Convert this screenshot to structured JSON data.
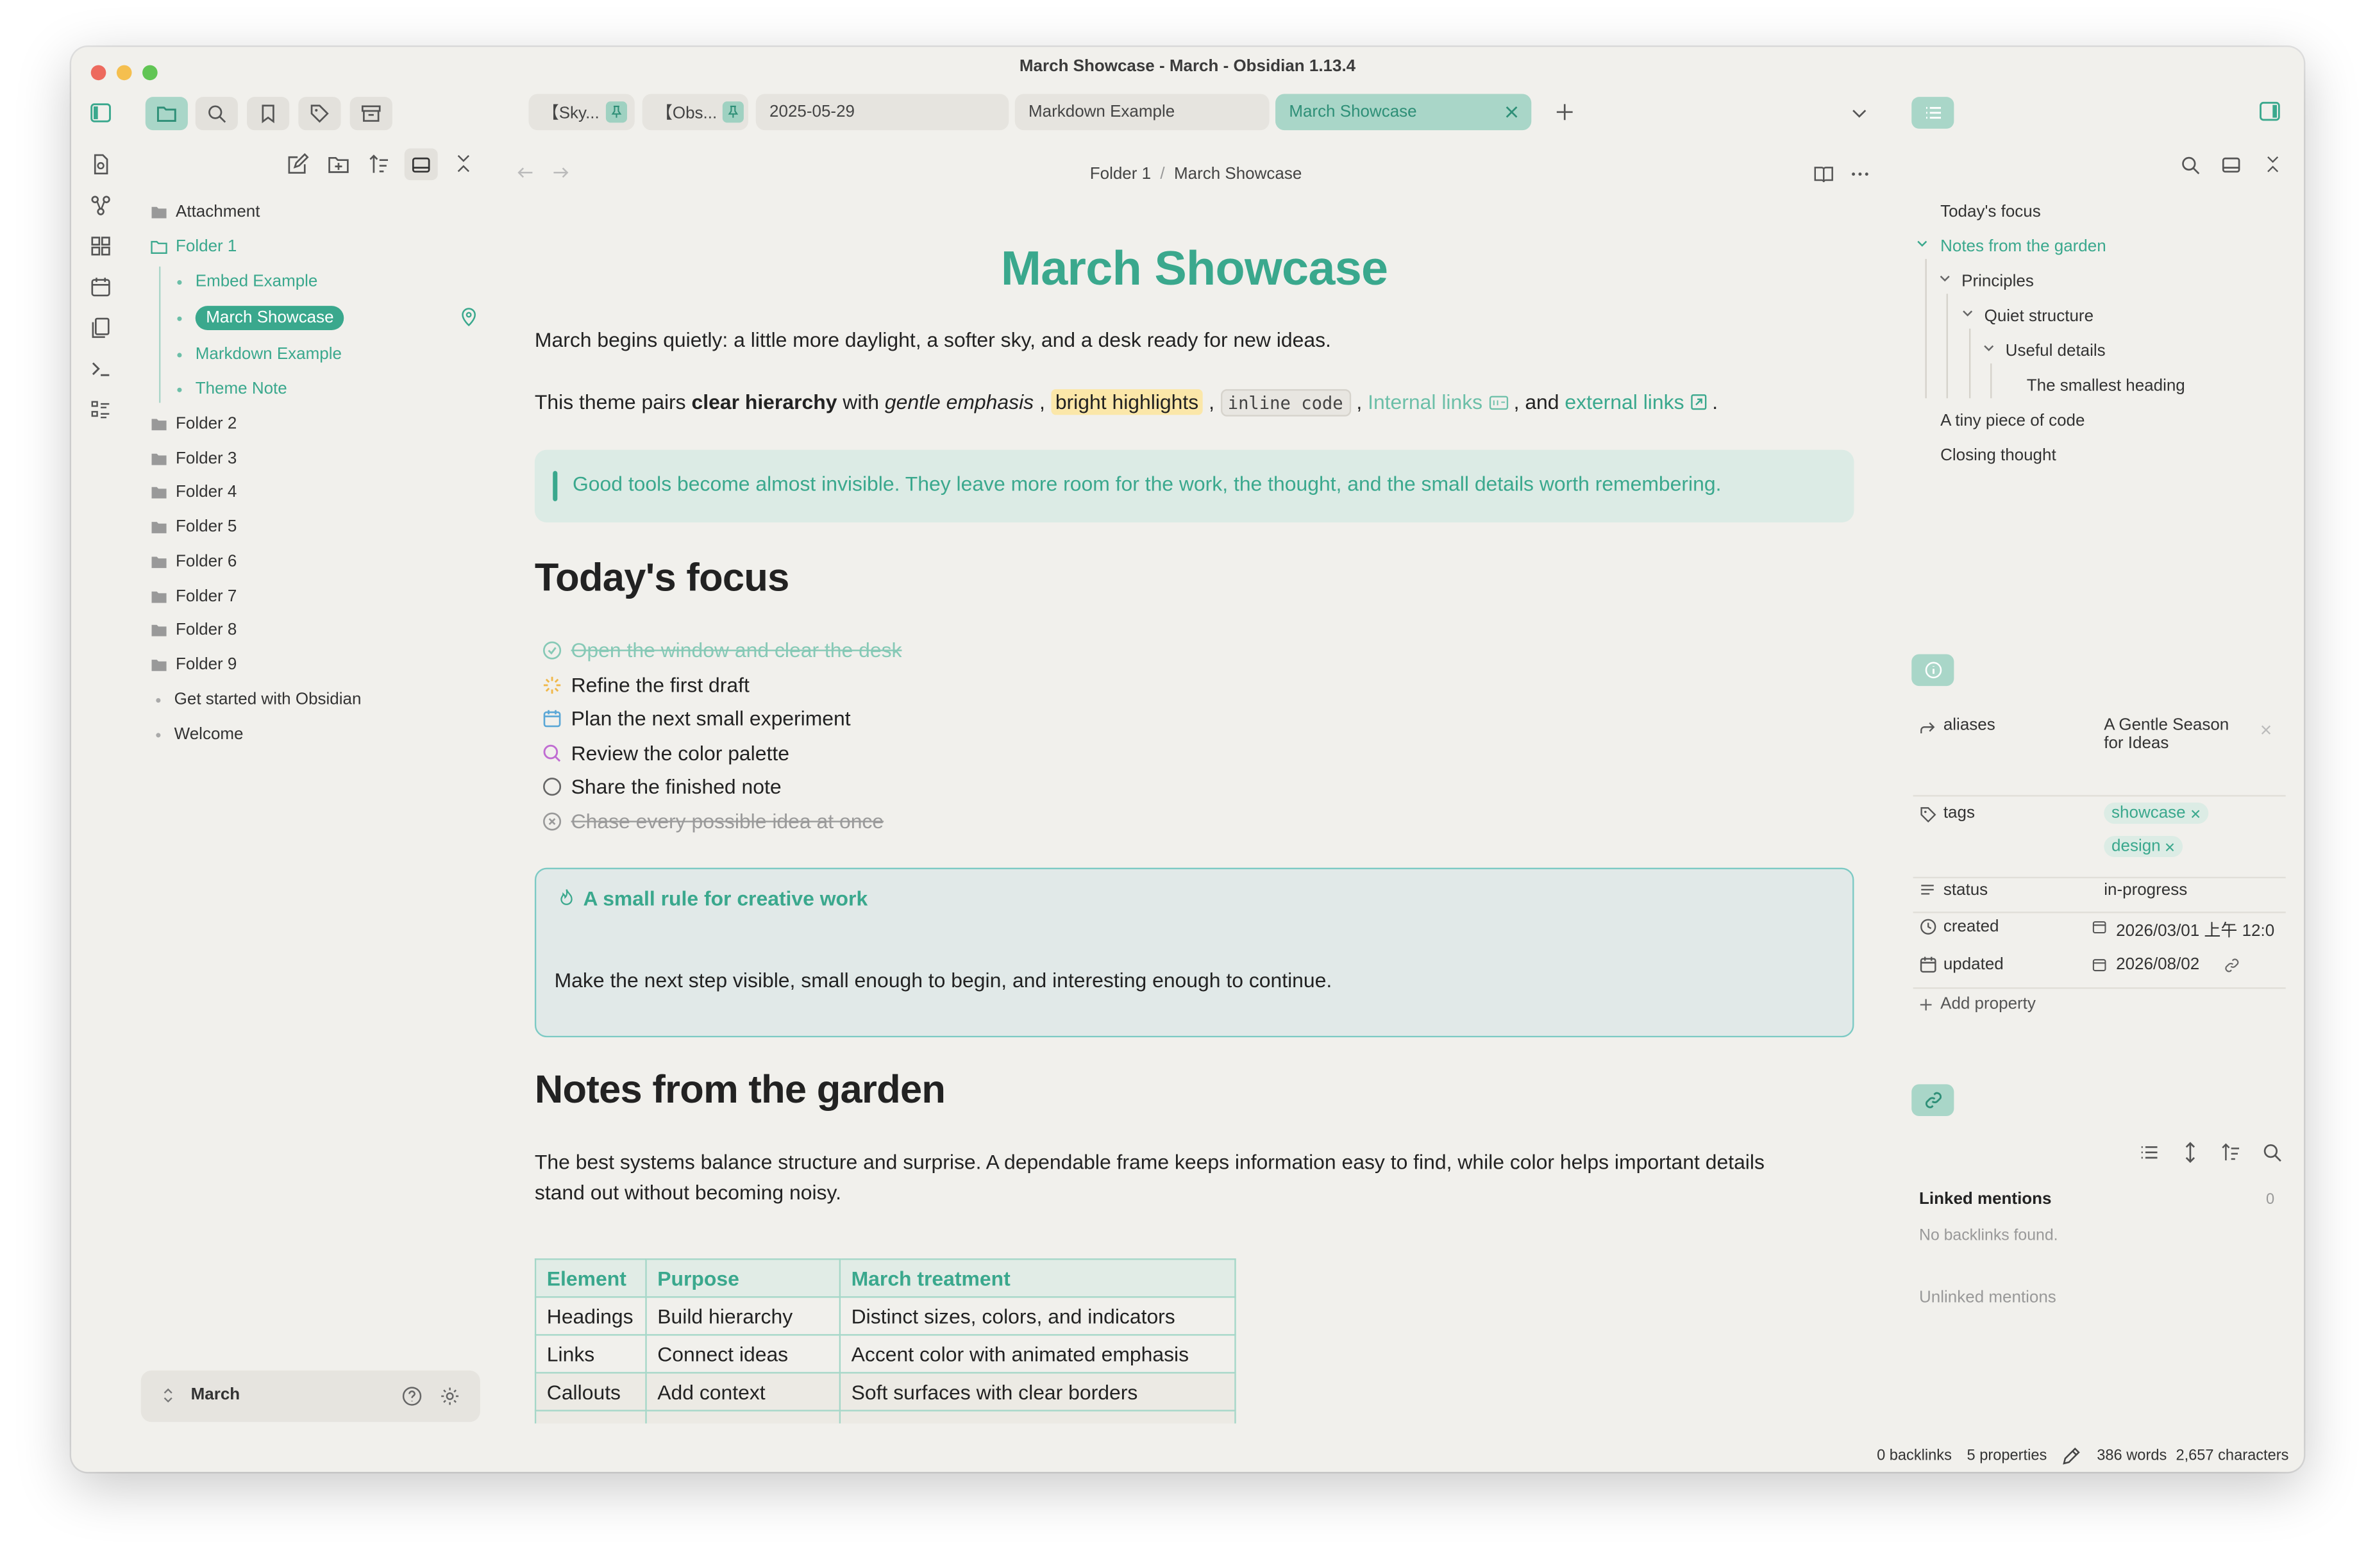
{
  "window": {
    "title": "March Showcase - March - Obsidian 1.13.4"
  },
  "colors": {
    "accent": "#3aa88d",
    "accent_light": "#a9d6c8",
    "highlight": "#fbe7a9",
    "background": "#f1f0ec"
  },
  "sidebar": {
    "tools": [
      "folder-icon",
      "search-icon",
      "bookmark-icon",
      "tag-icon",
      "archive-icon"
    ],
    "file_actions": [
      "new-note-icon",
      "new-folder-icon",
      "sort-icon",
      "collapse-view-icon",
      "collapse-all-icon"
    ],
    "tree": {
      "attachment": "Attachment",
      "folder1": "Folder 1",
      "folder1_children": [
        "Embed Example",
        "March Showcase",
        "Markdown Example",
        "Theme Note"
      ],
      "folders": [
        "Folder 2",
        "Folder 3",
        "Folder 4",
        "Folder 5",
        "Folder 6",
        "Folder 7",
        "Folder 8",
        "Folder 9"
      ],
      "files": [
        "Get started with Obsidian",
        "Welcome"
      ]
    },
    "vault": "March"
  },
  "tabs": [
    {
      "label": "【Sky..."
    },
    {
      "label": "【Obs..."
    },
    {
      "label": "2025-05-29"
    },
    {
      "label": "Markdown Example"
    },
    {
      "label": "March Showcase"
    }
  ],
  "breadcrumb": {
    "folder": "Folder 1",
    "sep": "/",
    "note": "March Showcase"
  },
  "note": {
    "title": "March Showcase",
    "intro": "March begins quietly: a little more daylight, a softer sky, and a desk ready for new ideas.",
    "p2": {
      "a": "This theme pairs ",
      "bold": "clear hierarchy",
      "b": " with ",
      "italic": "gentle emphasis",
      "c": " , ",
      "highlight": "bright highlights",
      "d": " , ",
      "code": "inline code",
      "e": " , ",
      "internal": "Internal links",
      "f": " , and ",
      "external": "external links",
      "g": " ."
    },
    "quote": "Good tools become almost invisible. They leave more room for the work, the thought, and the small details worth remembering.",
    "h_focus": "Today's focus",
    "tasks": [
      {
        "text": "Open the window and clear the desk",
        "state": "done"
      },
      {
        "text": "Refine the first draft",
        "state": "in-progress"
      },
      {
        "text": "Plan the next small experiment",
        "state": "scheduled"
      },
      {
        "text": "Review the color palette",
        "state": "review"
      },
      {
        "text": "Share the finished note",
        "state": "todo"
      },
      {
        "text": "Chase every possible idea at once",
        "state": "cancelled"
      }
    ],
    "callout": {
      "title": "A small rule for creative work",
      "body": "Make the next step visible, small enough to begin, and interesting enough to continue."
    },
    "h_garden": "Notes from the garden",
    "garden_p1": "The best systems balance structure and surprise. A dependable frame keeps information easy to find, while color helps important details",
    "garden_p2": "stand out without becoming noisy.",
    "table": {
      "headers": [
        "Element",
        "Purpose",
        "March treatment"
      ],
      "rows": [
        [
          "Headings",
          "Build hierarchy",
          "Distinct sizes, colors, and indicators"
        ],
        [
          "Links",
          "Connect ideas",
          "Accent color with animated emphasis"
        ],
        [
          "Callouts",
          "Add context",
          "Soft surfaces with clear borders"
        ]
      ]
    }
  },
  "outline": {
    "items": [
      "Today's focus",
      "Notes from the garden",
      "Principles",
      "Quiet structure",
      "Useful details",
      "The smallest heading",
      "A tiny piece of code",
      "Closing thought"
    ]
  },
  "properties": {
    "aliases": {
      "key": "aliases",
      "value_line1": "A Gentle Season",
      "value_line2": "for Ideas"
    },
    "tags": {
      "key": "tags",
      "values": [
        "showcase",
        "design"
      ]
    },
    "status": {
      "key": "status",
      "value": "in-progress"
    },
    "created": {
      "key": "created",
      "value": "2026/03/01 上午 12:0"
    },
    "updated": {
      "key": "updated",
      "value": "2026/08/02"
    },
    "add_label": "Add property"
  },
  "backlinks": {
    "linked_label": "Linked mentions",
    "linked_count": "0",
    "none": "No backlinks found.",
    "unlinked_label": "Unlinked mentions"
  },
  "status_bar": {
    "backlinks": "0 backlinks",
    "properties": "5 properties",
    "words": "386 words",
    "characters": "2,657 characters"
  }
}
